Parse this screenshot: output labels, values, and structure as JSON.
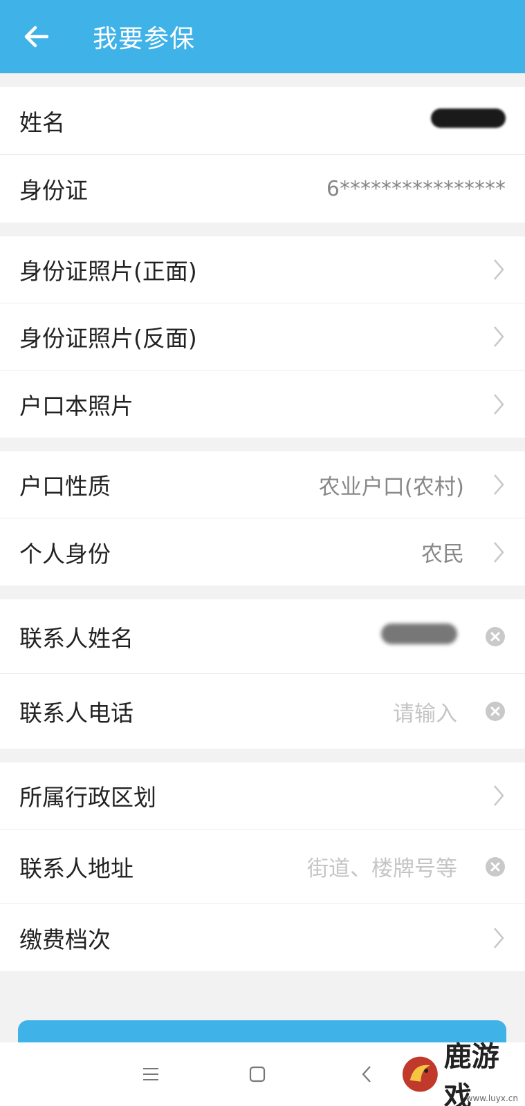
{
  "header": {
    "title": "我要参保",
    "back_icon": "arrow-left-icon"
  },
  "groups": [
    {
      "rows": [
        {
          "label": "姓名",
          "value": "",
          "redacted": true
        },
        {
          "label": "身份证",
          "value": "6****************"
        }
      ]
    },
    {
      "rows": [
        {
          "label": "身份证照片(正面)"
        },
        {
          "label": "身份证照片(反面)"
        },
        {
          "label": "户口本照片"
        }
      ]
    },
    {
      "rows": [
        {
          "label": "户口性质",
          "value": "农业户口(农村)"
        },
        {
          "label": "个人身份",
          "value": "农民"
        }
      ]
    },
    {
      "rows": [
        {
          "label": "联系人姓名",
          "value": "",
          "redacted": true
        },
        {
          "label": "联系人电话",
          "placeholder": "请输入"
        }
      ]
    },
    {
      "rows": [
        {
          "label": "所属行政区划"
        },
        {
          "label": "联系人地址",
          "placeholder": "街道、楼牌号等"
        },
        {
          "label": "缴费档次"
        }
      ]
    }
  ],
  "watermark": {
    "text": "鹿游戏",
    "url": "www.luyx.cn"
  },
  "colors": {
    "primary": "#3fb2e8",
    "background": "#f2f2f2"
  }
}
